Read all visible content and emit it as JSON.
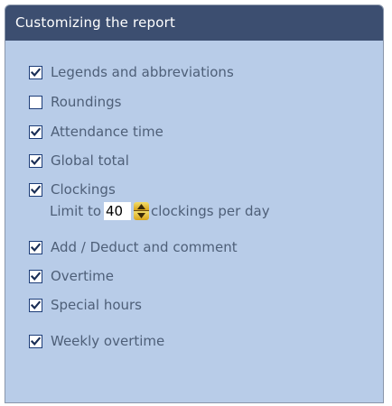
{
  "panel": {
    "title": "Customizing the report"
  },
  "options": [
    {
      "key": "legends",
      "label": "Legends and abbreviations",
      "checked": true
    },
    {
      "key": "roundings",
      "label": "Roundings",
      "checked": false
    },
    {
      "key": "attendance",
      "label": "Attendance time",
      "checked": true
    },
    {
      "key": "global_total",
      "label": "Global total",
      "checked": true
    },
    {
      "key": "clockings",
      "label": "Clockings",
      "checked": true
    },
    {
      "key": "add_deduct",
      "label": "Add / Deduct and comment",
      "checked": true
    },
    {
      "key": "overtime",
      "label": "Overtime",
      "checked": true
    },
    {
      "key": "special_hours",
      "label": "Special hours",
      "checked": true
    },
    {
      "key": "weekly_overtime",
      "label": "Weekly overtime",
      "checked": true
    }
  ],
  "clockings_limit": {
    "prefix": "Limit to",
    "value": "40",
    "suffix": "clockings per day"
  },
  "icons": {
    "checkbox_checked": "check-icon",
    "spinner_up": "arrow-up-icon",
    "spinner_down": "arrow-down-icon"
  },
  "colors": {
    "header_bg": "#3c4e70",
    "panel_bg": "#b8cce8",
    "label_text": "#4e5f78",
    "checkbox_border": "#1c3c78",
    "spinner": "#e8c040"
  }
}
